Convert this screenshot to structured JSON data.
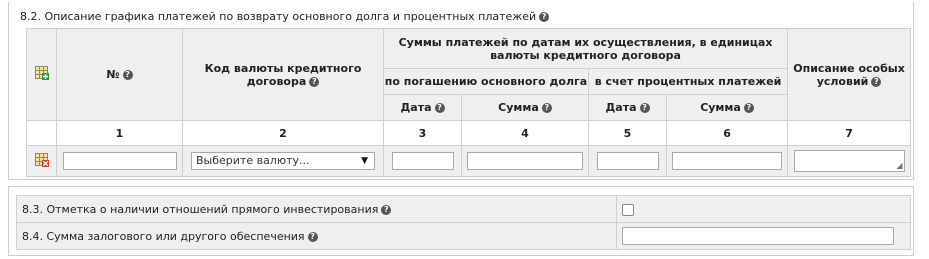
{
  "section_8_2": {
    "title": "8.2. Описание графика платежей по возврату основного долга и процентных платежей",
    "headers": {
      "number": "№",
      "currency_code": "Код валюты кредитного договора",
      "payments_group": "Суммы платежей по датам их осуществления, в единицах валюты кредитного договора",
      "principal": "по погашению основного долга",
      "interest": "в счет процентных платежей",
      "date": "Дата",
      "amount": "Сумма",
      "special_terms": "Описание особых условий"
    },
    "column_numbers": [
      "1",
      "2",
      "3",
      "4",
      "5",
      "6",
      "7"
    ],
    "row": {
      "number": "",
      "currency_select": "Выберите валюту...",
      "principal_date": "",
      "principal_amount": "",
      "interest_date": "",
      "interest_amount": "",
      "special_terms": ""
    }
  },
  "section_8_3": {
    "label": "8.3. Отметка о наличии отношений прямого инвестирования",
    "checked": false
  },
  "section_8_4": {
    "label": "8.4. Сумма залогового или другого обеспечения",
    "value": ""
  },
  "icons": {
    "help": "question-mark-help-icon",
    "add_row": "add-row-grid-icon",
    "delete_row": "delete-row-grid-icon"
  },
  "colors": {
    "header_bg": "#efefef",
    "border": "#cfcfcf",
    "help_icon": "#555555"
  }
}
